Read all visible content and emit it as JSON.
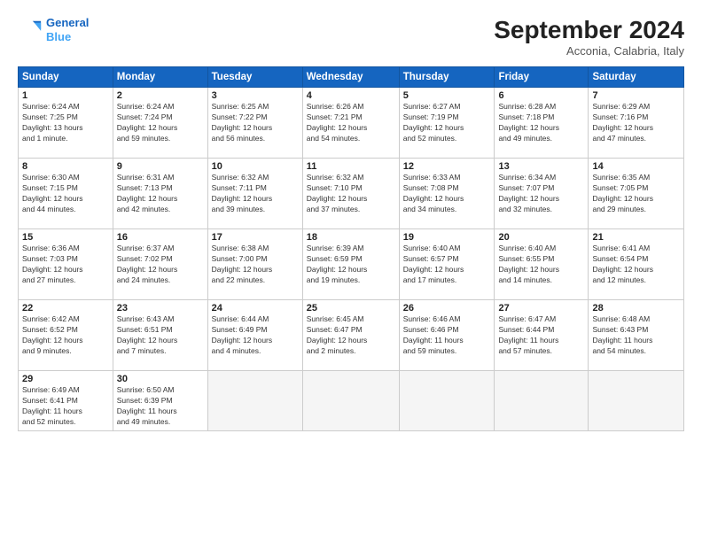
{
  "logo": {
    "line1": "General",
    "line2": "Blue"
  },
  "title": "September 2024",
  "subtitle": "Acconia, Calabria, Italy",
  "days_header": [
    "Sunday",
    "Monday",
    "Tuesday",
    "Wednesday",
    "Thursday",
    "Friday",
    "Saturday"
  ],
  "weeks": [
    [
      {
        "day": "1",
        "info": "Sunrise: 6:24 AM\nSunset: 7:25 PM\nDaylight: 13 hours\nand 1 minute."
      },
      {
        "day": "2",
        "info": "Sunrise: 6:24 AM\nSunset: 7:24 PM\nDaylight: 12 hours\nand 59 minutes."
      },
      {
        "day": "3",
        "info": "Sunrise: 6:25 AM\nSunset: 7:22 PM\nDaylight: 12 hours\nand 56 minutes."
      },
      {
        "day": "4",
        "info": "Sunrise: 6:26 AM\nSunset: 7:21 PM\nDaylight: 12 hours\nand 54 minutes."
      },
      {
        "day": "5",
        "info": "Sunrise: 6:27 AM\nSunset: 7:19 PM\nDaylight: 12 hours\nand 52 minutes."
      },
      {
        "day": "6",
        "info": "Sunrise: 6:28 AM\nSunset: 7:18 PM\nDaylight: 12 hours\nand 49 minutes."
      },
      {
        "day": "7",
        "info": "Sunrise: 6:29 AM\nSunset: 7:16 PM\nDaylight: 12 hours\nand 47 minutes."
      }
    ],
    [
      {
        "day": "8",
        "info": "Sunrise: 6:30 AM\nSunset: 7:15 PM\nDaylight: 12 hours\nand 44 minutes."
      },
      {
        "day": "9",
        "info": "Sunrise: 6:31 AM\nSunset: 7:13 PM\nDaylight: 12 hours\nand 42 minutes."
      },
      {
        "day": "10",
        "info": "Sunrise: 6:32 AM\nSunset: 7:11 PM\nDaylight: 12 hours\nand 39 minutes."
      },
      {
        "day": "11",
        "info": "Sunrise: 6:32 AM\nSunset: 7:10 PM\nDaylight: 12 hours\nand 37 minutes."
      },
      {
        "day": "12",
        "info": "Sunrise: 6:33 AM\nSunset: 7:08 PM\nDaylight: 12 hours\nand 34 minutes."
      },
      {
        "day": "13",
        "info": "Sunrise: 6:34 AM\nSunset: 7:07 PM\nDaylight: 12 hours\nand 32 minutes."
      },
      {
        "day": "14",
        "info": "Sunrise: 6:35 AM\nSunset: 7:05 PM\nDaylight: 12 hours\nand 29 minutes."
      }
    ],
    [
      {
        "day": "15",
        "info": "Sunrise: 6:36 AM\nSunset: 7:03 PM\nDaylight: 12 hours\nand 27 minutes."
      },
      {
        "day": "16",
        "info": "Sunrise: 6:37 AM\nSunset: 7:02 PM\nDaylight: 12 hours\nand 24 minutes."
      },
      {
        "day": "17",
        "info": "Sunrise: 6:38 AM\nSunset: 7:00 PM\nDaylight: 12 hours\nand 22 minutes."
      },
      {
        "day": "18",
        "info": "Sunrise: 6:39 AM\nSunset: 6:59 PM\nDaylight: 12 hours\nand 19 minutes."
      },
      {
        "day": "19",
        "info": "Sunrise: 6:40 AM\nSunset: 6:57 PM\nDaylight: 12 hours\nand 17 minutes."
      },
      {
        "day": "20",
        "info": "Sunrise: 6:40 AM\nSunset: 6:55 PM\nDaylight: 12 hours\nand 14 minutes."
      },
      {
        "day": "21",
        "info": "Sunrise: 6:41 AM\nSunset: 6:54 PM\nDaylight: 12 hours\nand 12 minutes."
      }
    ],
    [
      {
        "day": "22",
        "info": "Sunrise: 6:42 AM\nSunset: 6:52 PM\nDaylight: 12 hours\nand 9 minutes."
      },
      {
        "day": "23",
        "info": "Sunrise: 6:43 AM\nSunset: 6:51 PM\nDaylight: 12 hours\nand 7 minutes."
      },
      {
        "day": "24",
        "info": "Sunrise: 6:44 AM\nSunset: 6:49 PM\nDaylight: 12 hours\nand 4 minutes."
      },
      {
        "day": "25",
        "info": "Sunrise: 6:45 AM\nSunset: 6:47 PM\nDaylight: 12 hours\nand 2 minutes."
      },
      {
        "day": "26",
        "info": "Sunrise: 6:46 AM\nSunset: 6:46 PM\nDaylight: 11 hours\nand 59 minutes."
      },
      {
        "day": "27",
        "info": "Sunrise: 6:47 AM\nSunset: 6:44 PM\nDaylight: 11 hours\nand 57 minutes."
      },
      {
        "day": "28",
        "info": "Sunrise: 6:48 AM\nSunset: 6:43 PM\nDaylight: 11 hours\nand 54 minutes."
      }
    ],
    [
      {
        "day": "29",
        "info": "Sunrise: 6:49 AM\nSunset: 6:41 PM\nDaylight: 11 hours\nand 52 minutes."
      },
      {
        "day": "30",
        "info": "Sunrise: 6:50 AM\nSunset: 6:39 PM\nDaylight: 11 hours\nand 49 minutes."
      },
      {
        "day": "",
        "info": ""
      },
      {
        "day": "",
        "info": ""
      },
      {
        "day": "",
        "info": ""
      },
      {
        "day": "",
        "info": ""
      },
      {
        "day": "",
        "info": ""
      }
    ]
  ]
}
